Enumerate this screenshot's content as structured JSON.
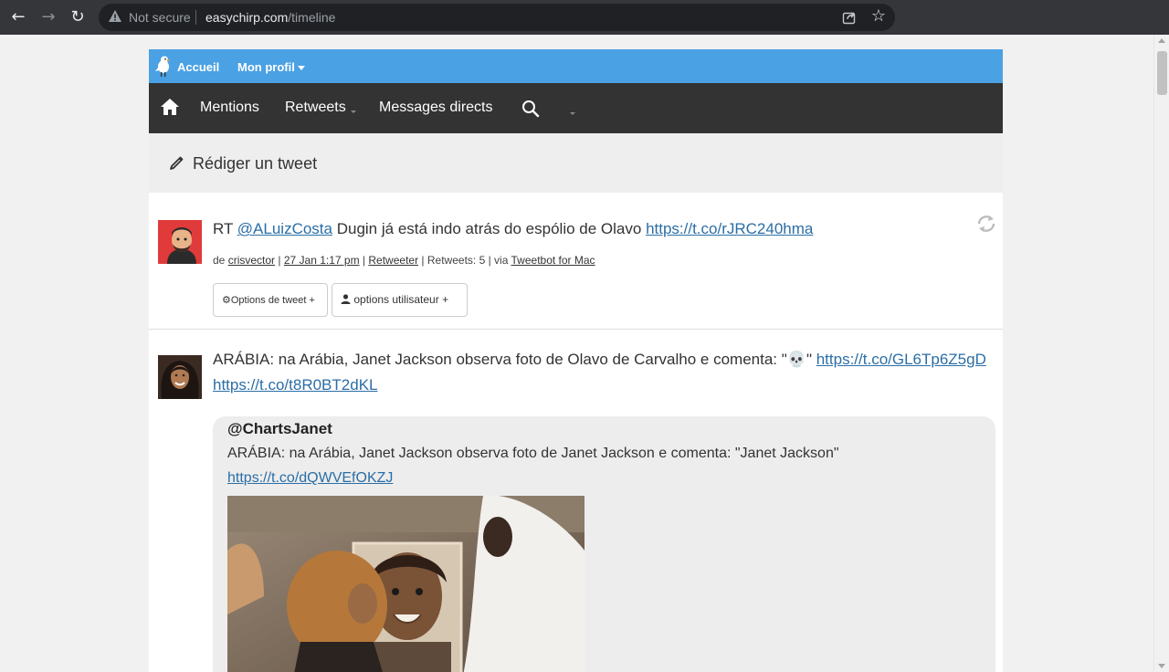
{
  "browser": {
    "security_label": "Not secure",
    "url_host": "easychirp.com",
    "url_path": "/timeline"
  },
  "topbar": {
    "home_label": "Accueil",
    "profile_label": "Mon profil"
  },
  "navbar": {
    "mentions": "Mentions",
    "retweets": "Retweets",
    "direct_messages": "Messages directs"
  },
  "compose": {
    "label": "Rédiger un tweet"
  },
  "tweets": [
    {
      "prefix": "RT",
      "mention": "@ALuizCosta",
      "text": "Dugin já está indo atrás do espólio de Olavo",
      "link": "https://t.co/rJRC240hma",
      "meta": {
        "from_label": "de",
        "user": "crisvector",
        "date": "27 Jan 1:17 pm",
        "retweet_label": "Retweeter",
        "retweets_count": "Retweets: 5",
        "via_label": "via",
        "client": "Tweetbot for Mac"
      },
      "tweet_options": "Options de tweet +",
      "user_options": "options utilisateur +"
    },
    {
      "text": "ARÁBIA: na Arábia, Janet Jackson observa foto de Olavo de Carvalho e comenta: \"💀\"",
      "link1": "https://t.co/GL6Tp6Z5gD",
      "link2": "https://t.co/t8R0BT2dKL",
      "quote": {
        "author": "@ChartsJanet",
        "text": "ARÁBIA: na Arábia, Janet Jackson observa foto de Janet Jackson e comenta: \"Janet Jackson\"",
        "link": "https://t.co/dQWVEfOKZJ"
      }
    }
  ]
}
